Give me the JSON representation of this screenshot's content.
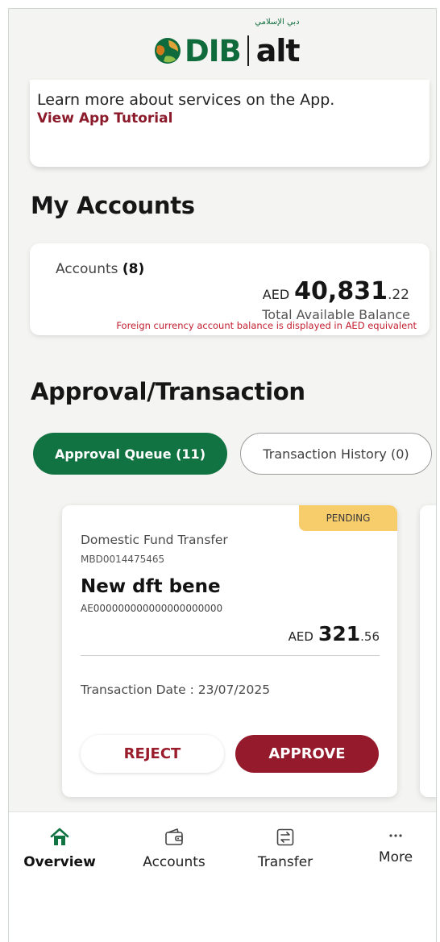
{
  "brand": {
    "logo_primary": "DIB",
    "logo_arabic": "دبي الإسلامي",
    "logo_secondary": "alt",
    "colors": {
      "green": "#0f6b3c",
      "maroon": "#8b1a2b",
      "orange": "#d17a1c"
    }
  },
  "tutorial": {
    "text": "Learn more about services on the App.",
    "link": "View App Tutorial"
  },
  "accounts_section": {
    "title": "My Accounts",
    "accounts_label": "Accounts",
    "accounts_count": "(8)",
    "currency": "AED",
    "balance_main": "40,831",
    "balance_decimal": ".22",
    "balance_caption": "Total Available Balance",
    "note": "Foreign currency account balance is displayed in AED equivalent"
  },
  "approval_section": {
    "title": "Approval/Transaction",
    "tabs": [
      {
        "label": "Approval Queue (11)",
        "active": true
      },
      {
        "label": "Transaction History (0)",
        "active": false
      }
    ]
  },
  "transaction_card": {
    "status": "PENDING",
    "type": "Domestic Fund Transfer",
    "reference": "MBD0014475465",
    "beneficiary": "New dft bene",
    "iban": "AE000000000000000000000",
    "currency": "AED",
    "amount_main": "321",
    "amount_decimal": ".56",
    "date": "Transaction Date : 23/07/2025",
    "reject_label": "REJECT",
    "approve_label": "APPROVE"
  },
  "bottom_nav": {
    "items": [
      {
        "label": "Overview",
        "icon": "home-icon",
        "active": true
      },
      {
        "label": "Accounts",
        "icon": "wallet-icon",
        "active": false
      },
      {
        "label": "Transfer",
        "icon": "transfer-icon",
        "active": false
      },
      {
        "label": "More",
        "icon": "more-dots-icon",
        "active": false
      }
    ]
  }
}
